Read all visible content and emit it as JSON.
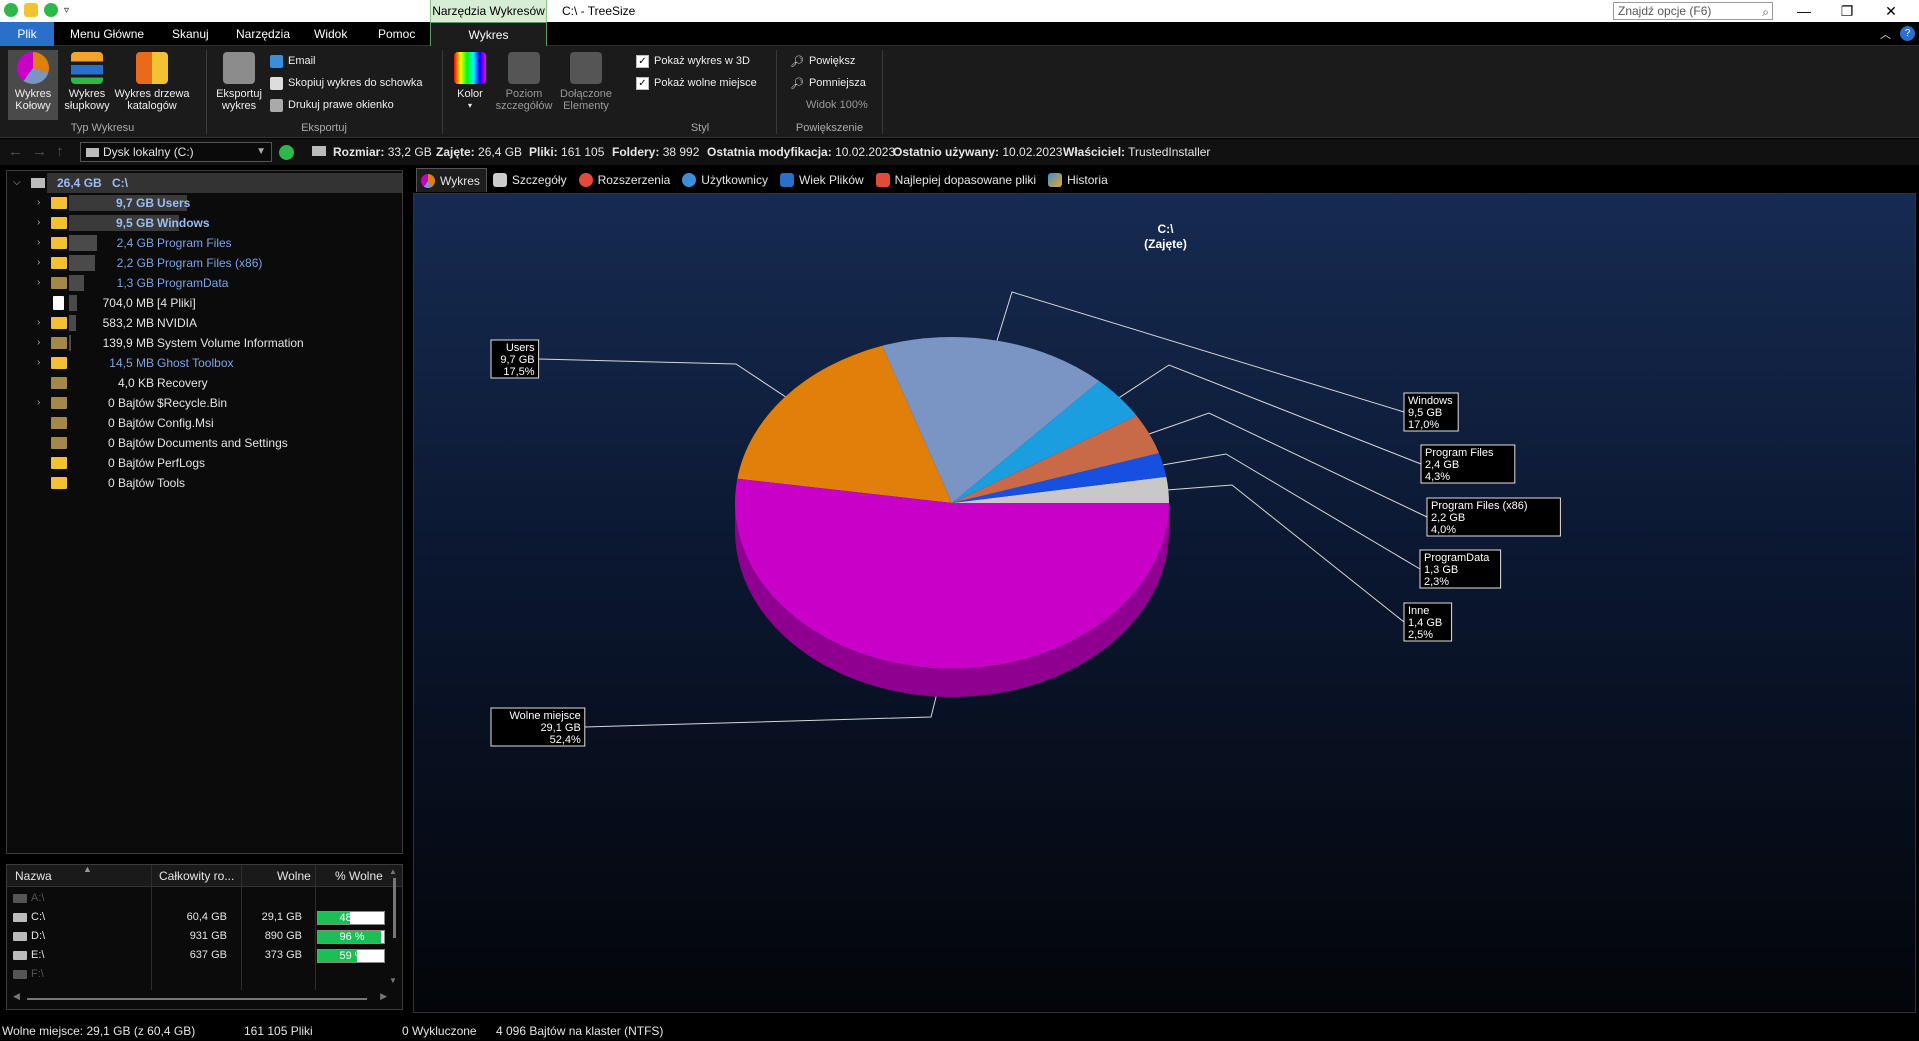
{
  "titlebar": {
    "context_tab": "Narzędzia Wykresów",
    "window_title": "C:\\ - TreeSize",
    "search_placeholder": "Znajdź opcje (F6)"
  },
  "tabs": {
    "file": "Plik",
    "items": [
      "Menu Główne",
      "Skanuj",
      "Narzędzia",
      "Widok",
      "Pomoc"
    ],
    "active": "Wykres"
  },
  "ribbon": {
    "chart_type": {
      "pie": "Wykres Kołowy",
      "bar": "Wykres słupkowy",
      "tree": "Wykres drzewa katalogów",
      "group": "Typ Wykresu"
    },
    "export": {
      "export_chart": "Eksportuj wykres",
      "email": "Email",
      "copy": "Skopiuj wykres do schowka",
      "print": "Drukuj prawe okienko",
      "group": "Eksportuj"
    },
    "style": {
      "color": "Kolor",
      "detail": "Poziom szczegółów",
      "attached": "Dołączone Elementy",
      "show3d": "Pokaż wykres w 3D",
      "showfree": "Pokaż wolne miejsce",
      "group": "Styl"
    },
    "zoom": {
      "zoom_in": "Powiększ",
      "zoom_out": "Pomniejsza",
      "view": "Widok 100%",
      "group": "Powiększenie"
    }
  },
  "addressbar": {
    "drive": "Dysk lokalny (C:)",
    "size_label": "Rozmiar:",
    "size": "33,2 GB",
    "used_label": "Zajęte:",
    "used": "26,4 GB",
    "files_label": "Pliki:",
    "files": "161 105",
    "folders_label": "Foldery:",
    "folders": "38 992",
    "modified_label": "Ostatnia modyfikacja:",
    "modified": "10.02.2023",
    "accessed_label": "Ostatnio używany:",
    "accessed": "10.02.2023",
    "owner_label": "Właściciel:",
    "owner": "TrustedInstaller"
  },
  "tree": {
    "root": {
      "size": "26,4 GB",
      "name": "C:\\"
    },
    "items": [
      {
        "size": "9,7 GB",
        "name": "Users"
      },
      {
        "size": "9,5 GB",
        "name": "Windows"
      },
      {
        "size": "2,4 GB",
        "name": "Program Files"
      },
      {
        "size": "2,2 GB",
        "name": "Program Files (x86)"
      },
      {
        "size": "1,3 GB",
        "name": "ProgramData"
      },
      {
        "size": "704,0 MB",
        "name": "[4 Pliki]"
      },
      {
        "size": "583,2 MB",
        "name": "NVIDIA"
      },
      {
        "size": "139,9 MB",
        "name": "System Volume Information"
      },
      {
        "size": "14,5 MB",
        "name": "Ghost Toolbox"
      },
      {
        "size": "4,0 KB",
        "name": "Recovery"
      },
      {
        "size": "0 Bajtów",
        "name": "$Recycle.Bin"
      },
      {
        "size": "0 Bajtów",
        "name": "Config.Msi"
      },
      {
        "size": "0 Bajtów",
        "name": "Documents and Settings"
      },
      {
        "size": "0 Bajtów",
        "name": "PerfLogs"
      },
      {
        "size": "0 Bajtów",
        "name": "Tools"
      }
    ]
  },
  "drives": {
    "headers": [
      "Nazwa",
      "Całkowity ro...",
      "Wolne",
      "% Wolne"
    ],
    "rows": [
      {
        "name": "A:\\",
        "total": "",
        "free": "",
        "pct": ""
      },
      {
        "name": "C:\\",
        "total": "60,4 GB",
        "free": "29,1 GB",
        "pct": "48 %",
        "pct_value": 48
      },
      {
        "name": "D:\\",
        "total": "931 GB",
        "free": "890 GB",
        "pct": "96 %",
        "pct_value": 96
      },
      {
        "name": "E:\\",
        "total": "637 GB",
        "free": "373 GB",
        "pct": "59 %",
        "pct_value": 59
      },
      {
        "name": "F:\\",
        "total": "",
        "free": "",
        "pct": ""
      }
    ]
  },
  "chart_tabs": [
    "Wykres",
    "Szczegóły",
    "Rozszerzenia",
    "Użytkownicy",
    "Wiek Plików",
    "Najlepiej dopasowane pliki",
    "Historia"
  ],
  "chart_data": {
    "type": "pie",
    "title": "C:\\",
    "subtitle": "(Zajęte)",
    "slices": [
      {
        "name": "Users",
        "value": 9.7,
        "label": "9,7 GB",
        "pct": "17,5%",
        "color": "#e0800a"
      },
      {
        "name": "Windows",
        "value": 9.5,
        "label": "9,5 GB",
        "pct": "17,0%",
        "color": "#7a95c4"
      },
      {
        "name": "Program Files",
        "value": 2.4,
        "label": "2,4 GB",
        "pct": "4,3%",
        "color": "#1a9ee0"
      },
      {
        "name": "Program Files (x86)",
        "value": 2.2,
        "label": "2,2 GB",
        "pct": "4,0%",
        "color": "#c86a48"
      },
      {
        "name": "ProgramData",
        "value": 1.3,
        "label": "1,3 GB",
        "pct": "2,3%",
        "color": "#1650e0"
      },
      {
        "name": "Inne",
        "value": 1.4,
        "label": "1,4 GB",
        "pct": "2,5%",
        "color": "#c8c8c8"
      },
      {
        "name": "Wolne miejsce",
        "value": 29.1,
        "label": "29,1 GB",
        "pct": "52,4%",
        "color": "#c800c8"
      }
    ],
    "three_d": true
  },
  "status": {
    "free": "Wolne miejsce: 29,1 GB  (z 60,4 GB)",
    "files": "161 105 Pliki",
    "excluded": "0 Wykluczone",
    "cluster": "4 096 Bajtów na klaster (NTFS)"
  }
}
